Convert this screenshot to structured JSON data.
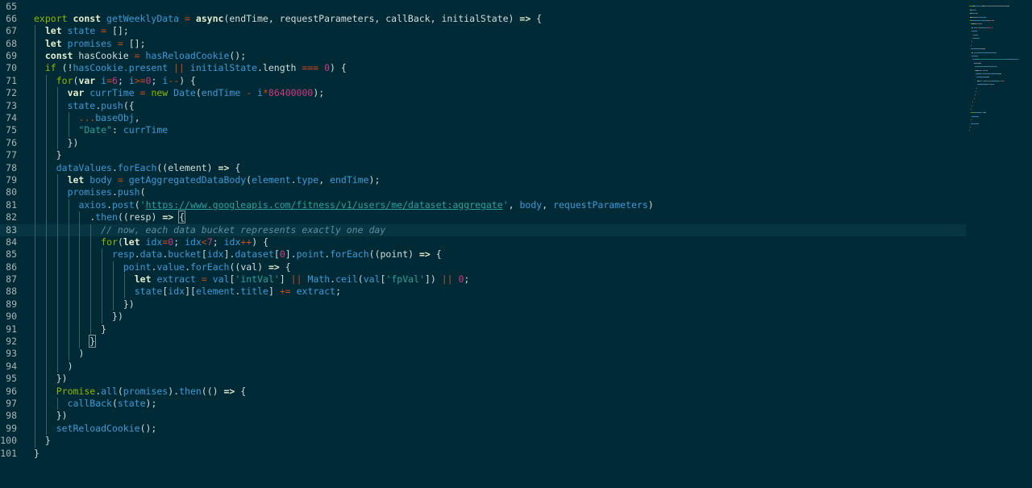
{
  "editor": {
    "current_line": 83,
    "lines": [
      {
        "n": "65",
        "indent": 0,
        "tokens": []
      },
      {
        "n": "66",
        "indent": 0,
        "tokens": [
          [
            "export ",
            "gk"
          ],
          [
            "const ",
            "kw"
          ],
          [
            "getWeeklyData ",
            "fn"
          ],
          [
            "= ",
            "op"
          ],
          [
            "async",
            "kw"
          ],
          [
            "(endTime, requestParameters, callBack, initialState) ",
            "pl"
          ],
          [
            "=>",
            "kw"
          ],
          [
            " {",
            "pl"
          ]
        ]
      },
      {
        "n": "67",
        "indent": 1,
        "tokens": [
          [
            "let ",
            "kw"
          ],
          [
            "state ",
            "vr"
          ],
          [
            "= ",
            "op"
          ],
          [
            "[];",
            "pl"
          ]
        ]
      },
      {
        "n": "68",
        "indent": 1,
        "tokens": [
          [
            "let ",
            "kw"
          ],
          [
            "promises ",
            "vr"
          ],
          [
            "= ",
            "op"
          ],
          [
            "[];",
            "pl"
          ]
        ]
      },
      {
        "n": "69",
        "indent": 1,
        "tokens": [
          [
            "const ",
            "kw"
          ],
          [
            "hasCookie ",
            "pl"
          ],
          [
            "= ",
            "op"
          ],
          [
            "hasReloadCookie",
            "fn"
          ],
          [
            "();",
            "pl"
          ]
        ]
      },
      {
        "n": "70",
        "indent": 1,
        "tokens": [
          [
            "if ",
            "gk"
          ],
          [
            "(!",
            "pl"
          ],
          [
            "hasCookie.present ",
            "vr"
          ],
          [
            "|| ",
            "op"
          ],
          [
            "initialState",
            "vr"
          ],
          [
            ".length ",
            "pl"
          ],
          [
            "=== ",
            "op"
          ],
          [
            "0",
            "nm"
          ],
          [
            ") {",
            "pl"
          ]
        ]
      },
      {
        "n": "71",
        "indent": 2,
        "tokens": [
          [
            "for",
            "gk"
          ],
          [
            "(",
            "pl"
          ],
          [
            "var ",
            "kw"
          ],
          [
            "i",
            "vr"
          ],
          [
            "=",
            "op"
          ],
          [
            "6",
            "nm"
          ],
          [
            "; ",
            "pl"
          ],
          [
            "i",
            "vr"
          ],
          [
            ">=",
            "op"
          ],
          [
            "0",
            "nm"
          ],
          [
            "; ",
            "pl"
          ],
          [
            "i",
            "vr"
          ],
          [
            "--",
            "op"
          ],
          [
            ") {",
            "pl"
          ]
        ]
      },
      {
        "n": "72",
        "indent": 3,
        "tokens": [
          [
            "var ",
            "kw"
          ],
          [
            "currTime ",
            "vr"
          ],
          [
            "= ",
            "op"
          ],
          [
            "new ",
            "gk"
          ],
          [
            "Date",
            "fn"
          ],
          [
            "(",
            "pl"
          ],
          [
            "endTime ",
            "vr"
          ],
          [
            "- ",
            "op"
          ],
          [
            "i",
            "vr"
          ],
          [
            "*",
            "op"
          ],
          [
            "86400000",
            "nm"
          ],
          [
            ");",
            "pl"
          ]
        ]
      },
      {
        "n": "73",
        "indent": 3,
        "tokens": [
          [
            "state",
            "vr"
          ],
          [
            ".",
            "pl"
          ],
          [
            "push",
            "fn"
          ],
          [
            "({",
            "pl"
          ]
        ]
      },
      {
        "n": "74",
        "indent": 4,
        "tokens": [
          [
            "...",
            "op"
          ],
          [
            "baseObj",
            "vr"
          ],
          [
            ",",
            "pl"
          ]
        ]
      },
      {
        "n": "75",
        "indent": 4,
        "tokens": [
          [
            "\"Date\"",
            "st"
          ],
          [
            ": ",
            "pl"
          ],
          [
            "currTime",
            "vr"
          ]
        ]
      },
      {
        "n": "76",
        "indent": 3,
        "tokens": [
          [
            "})",
            "pl"
          ]
        ]
      },
      {
        "n": "77",
        "indent": 2,
        "tokens": [
          [
            "}",
            "pl"
          ]
        ]
      },
      {
        "n": "78",
        "indent": 2,
        "tokens": [
          [
            "dataValues",
            "vr"
          ],
          [
            ".",
            "pl"
          ],
          [
            "forEach",
            "fn"
          ],
          [
            "((element) ",
            "pl"
          ],
          [
            "=>",
            "kw"
          ],
          [
            " {",
            "pl"
          ]
        ]
      },
      {
        "n": "79",
        "indent": 3,
        "tokens": [
          [
            "let ",
            "kw"
          ],
          [
            "body ",
            "vr"
          ],
          [
            "= ",
            "op"
          ],
          [
            "getAggregatedDataBody",
            "fn"
          ],
          [
            "(",
            "pl"
          ],
          [
            "element",
            "vr"
          ],
          [
            ".",
            "pl"
          ],
          [
            "type",
            "vr"
          ],
          [
            ", ",
            "pl"
          ],
          [
            "endTime",
            "vr"
          ],
          [
            ");",
            "pl"
          ]
        ]
      },
      {
        "n": "80",
        "indent": 3,
        "tokens": [
          [
            "promises",
            "vr"
          ],
          [
            ".",
            "pl"
          ],
          [
            "push",
            "fn"
          ],
          [
            "(",
            "pl"
          ]
        ]
      },
      {
        "n": "81",
        "indent": 4,
        "tokens": [
          [
            "axios",
            "vr"
          ],
          [
            ".",
            "pl"
          ],
          [
            "post",
            "fn"
          ],
          [
            "(",
            "pl"
          ],
          [
            "'",
            "st"
          ],
          [
            "https://www.googleapis.com/fitness/v1/users/me/dataset:aggregate",
            "st url"
          ],
          [
            "'",
            "st"
          ],
          [
            ", ",
            "pl"
          ],
          [
            "body",
            "vr"
          ],
          [
            ", ",
            "pl"
          ],
          [
            "requestParameters",
            "vr"
          ],
          [
            ")",
            "pl"
          ]
        ]
      },
      {
        "n": "82",
        "indent": 5,
        "tokens": [
          [
            ".",
            "pl"
          ],
          [
            "then",
            "fn"
          ],
          [
            "((resp) ",
            "pl"
          ],
          [
            "=>",
            "kw"
          ],
          [
            " ",
            "pl"
          ],
          [
            "{",
            "pl br"
          ]
        ]
      },
      {
        "n": "83",
        "indent": 6,
        "tokens": [
          [
            "// now, each data bucket represents exactly one day",
            "cm"
          ]
        ]
      },
      {
        "n": "84",
        "indent": 6,
        "tokens": [
          [
            "for",
            "gk"
          ],
          [
            "(",
            "pl"
          ],
          [
            "let ",
            "kw"
          ],
          [
            "idx",
            "vr"
          ],
          [
            "=",
            "op"
          ],
          [
            "0",
            "nm"
          ],
          [
            "; ",
            "pl"
          ],
          [
            "idx",
            "vr"
          ],
          [
            "<",
            "op"
          ],
          [
            "7",
            "nm"
          ],
          [
            "; ",
            "pl"
          ],
          [
            "idx",
            "vr"
          ],
          [
            "++",
            "op"
          ],
          [
            ") {",
            "pl"
          ]
        ]
      },
      {
        "n": "85",
        "indent": 7,
        "tokens": [
          [
            "resp",
            "vr"
          ],
          [
            ".",
            "pl"
          ],
          [
            "data",
            "vr"
          ],
          [
            ".",
            "pl"
          ],
          [
            "bucket",
            "vr"
          ],
          [
            "[",
            "pl"
          ],
          [
            "idx",
            "vr"
          ],
          [
            "].",
            "pl"
          ],
          [
            "dataset",
            "vr"
          ],
          [
            "[",
            "pl"
          ],
          [
            "0",
            "nm"
          ],
          [
            "].",
            "pl"
          ],
          [
            "point",
            "vr"
          ],
          [
            ".",
            "pl"
          ],
          [
            "forEach",
            "fn"
          ],
          [
            "((point) ",
            "pl"
          ],
          [
            "=>",
            "kw"
          ],
          [
            " {",
            "pl"
          ]
        ]
      },
      {
        "n": "86",
        "indent": 8,
        "tokens": [
          [
            "point",
            "vr"
          ],
          [
            ".",
            "pl"
          ],
          [
            "value",
            "vr"
          ],
          [
            ".",
            "pl"
          ],
          [
            "forEach",
            "fn"
          ],
          [
            "((val) ",
            "pl"
          ],
          [
            "=>",
            "kw"
          ],
          [
            " {",
            "pl"
          ]
        ]
      },
      {
        "n": "87",
        "indent": 9,
        "tokens": [
          [
            "let ",
            "kw"
          ],
          [
            "extract ",
            "vr"
          ],
          [
            "= ",
            "op"
          ],
          [
            "val",
            "vr"
          ],
          [
            "[",
            "pl"
          ],
          [
            "'intVal'",
            "st"
          ],
          [
            "] ",
            "pl"
          ],
          [
            "|| ",
            "op"
          ],
          [
            "Math",
            "vr"
          ],
          [
            ".",
            "pl"
          ],
          [
            "ceil",
            "fn"
          ],
          [
            "(",
            "pl"
          ],
          [
            "val",
            "vr"
          ],
          [
            "[",
            "pl"
          ],
          [
            "'fpVal'",
            "st"
          ],
          [
            "]) ",
            "pl"
          ],
          [
            "|| ",
            "op"
          ],
          [
            "0",
            "nm"
          ],
          [
            ";",
            "pl"
          ]
        ]
      },
      {
        "n": "88",
        "indent": 9,
        "tokens": [
          [
            "state",
            "vr"
          ],
          [
            "[",
            "pl"
          ],
          [
            "idx",
            "vr"
          ],
          [
            "][",
            "pl"
          ],
          [
            "element",
            "vr"
          ],
          [
            ".",
            "pl"
          ],
          [
            "title",
            "vr"
          ],
          [
            "] ",
            "pl"
          ],
          [
            "+= ",
            "op"
          ],
          [
            "extract",
            "vr"
          ],
          [
            ";",
            "pl"
          ]
        ]
      },
      {
        "n": "89",
        "indent": 8,
        "tokens": [
          [
            "})",
            "pl"
          ]
        ]
      },
      {
        "n": "90",
        "indent": 7,
        "tokens": [
          [
            "})",
            "pl"
          ]
        ]
      },
      {
        "n": "91",
        "indent": 6,
        "tokens": [
          [
            "}",
            "pl"
          ]
        ]
      },
      {
        "n": "92",
        "indent": 5,
        "tokens": [
          [
            "}",
            "pl br"
          ]
        ]
      },
      {
        "n": "93",
        "indent": 4,
        "tokens": [
          [
            ")",
            "pl"
          ]
        ]
      },
      {
        "n": "94",
        "indent": 3,
        "tokens": [
          [
            ")",
            "pl"
          ]
        ]
      },
      {
        "n": "95",
        "indent": 2,
        "tokens": [
          [
            "})",
            "pl"
          ]
        ]
      },
      {
        "n": "96",
        "indent": 2,
        "tokens": [
          [
            "Promise",
            "gk"
          ],
          [
            ".",
            "pl"
          ],
          [
            "all",
            "fn"
          ],
          [
            "(",
            "pl"
          ],
          [
            "promises",
            "vr"
          ],
          [
            ").",
            "pl"
          ],
          [
            "then",
            "fn"
          ],
          [
            "(() ",
            "pl"
          ],
          [
            "=>",
            "kw"
          ],
          [
            " {",
            "pl"
          ]
        ]
      },
      {
        "n": "97",
        "indent": 3,
        "tokens": [
          [
            "callBack",
            "fn"
          ],
          [
            "(",
            "pl"
          ],
          [
            "state",
            "vr"
          ],
          [
            ");",
            "pl"
          ]
        ]
      },
      {
        "n": "98",
        "indent": 2,
        "tokens": [
          [
            "})",
            "pl"
          ]
        ]
      },
      {
        "n": "99",
        "indent": 2,
        "tokens": [
          [
            "setReloadCookie",
            "fn"
          ],
          [
            "();",
            "pl"
          ]
        ]
      },
      {
        "n": "100",
        "indent": 1,
        "tokens": [
          [
            "}",
            "pl"
          ]
        ]
      },
      {
        "n": "101",
        "indent": 0,
        "tokens": [
          [
            "}",
            "pl"
          ]
        ]
      }
    ]
  },
  "colors": {
    "background": "#002b36",
    "current_line": "#073642",
    "keyword": "#e4ecd0",
    "green_keyword": "#93b400",
    "function": "#3d99d6",
    "number": "#d33682",
    "string": "#2aa198",
    "operator": "#cb4b16",
    "comment": "#5c8ea0"
  }
}
